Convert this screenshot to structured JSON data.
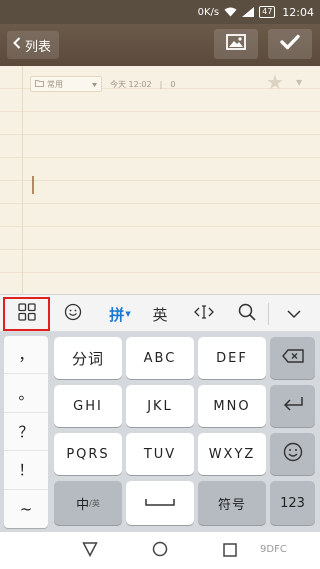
{
  "status_bar": {
    "speed": "0K/s",
    "battery": "47",
    "time": "12:04"
  },
  "header": {
    "back_label": "列表",
    "icons": {
      "back": "chevron-left-icon",
      "image": "image-icon",
      "save": "checkmark-icon"
    }
  },
  "note": {
    "category": "常用",
    "date": "今天 12:02",
    "count": "0",
    "icons": {
      "folder": "folder-icon",
      "dropdown": "chevron-down-icon",
      "favorite": "star-icon"
    }
  },
  "toolbar": {
    "items": [
      "grid-menu-icon",
      "emoji-icon",
      "拼",
      "英",
      "cursor-icon",
      "search-icon",
      "collapse-icon"
    ],
    "pinyin_label": "拼",
    "english_label": "英"
  },
  "keyboard": {
    "symbols": [
      "，",
      "。",
      "？",
      "！",
      "~"
    ],
    "keys": {
      "fenci": "分词",
      "abc": "ABC",
      "def": "DEF",
      "ghi": "GHI",
      "jkl": "JKL",
      "mno": "MNO",
      "pqrs": "PQRS",
      "tuv": "TUV",
      "wxyz": "WXYZ",
      "zh_main": "中",
      "zh_sub": "/英",
      "symbol": "符号",
      "num": "123"
    },
    "icons": {
      "backspace": "backspace-icon",
      "enter": "enter-icon",
      "emoji": "smiley-icon",
      "space": "space-icon"
    }
  },
  "nav_bar": {
    "watermark": "9DFC"
  },
  "colors": {
    "accent_pinyin": "#1a78d6",
    "header": "#5b4a3b",
    "paper": "#f7f1e3",
    "highlight": "#e02020"
  }
}
